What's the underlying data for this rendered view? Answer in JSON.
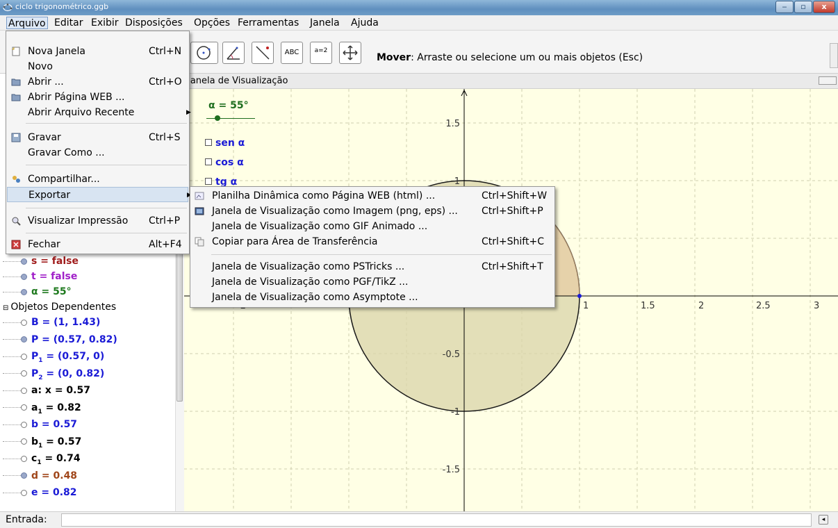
{
  "window": {
    "title": "ciclo trigonométrico.ggb",
    "min_label": "‒",
    "max_label": "▫",
    "close_label": "x"
  },
  "menubar": [
    "Arquivo",
    "Editar",
    "Exibir",
    "Disposições",
    "Opções",
    "Ferramentas",
    "Janela",
    "Ajuda"
  ],
  "toolbar": {
    "tools": [
      "circle-tool",
      "angle-tool",
      "slope-tool",
      "text-tool",
      "slider-tool",
      "move-view-tool"
    ],
    "text_tool_label": "ABC",
    "slider_tool_label": "a=2",
    "hint_bold": "Mover",
    "hint_rest": ": Arraste ou selecione um ou mais objetos (Esc)"
  },
  "file_menu": {
    "items": [
      {
        "label": "Nova Janela",
        "shortcut": "Ctrl+N"
      },
      {
        "label": "Novo",
        "shortcut": ""
      },
      {
        "label": "Abrir ...",
        "shortcut": "Ctrl+O"
      },
      {
        "label": "Abrir Página WEB ...",
        "shortcut": ""
      },
      {
        "label": "Abrir Arquivo Recente",
        "shortcut": ""
      },
      {
        "label": "Gravar",
        "shortcut": "Ctrl+S"
      },
      {
        "label": "Gravar Como ...",
        "shortcut": ""
      },
      {
        "label": "Compartilhar...",
        "shortcut": ""
      },
      {
        "label": "Exportar",
        "shortcut": ""
      },
      {
        "label": "Visualizar Impressão",
        "shortcut": "Ctrl+P"
      },
      {
        "label": "Fechar",
        "shortcut": "Alt+F4"
      }
    ]
  },
  "export_submenu": {
    "items": [
      {
        "label": "Planilha Dinâmica como Página WEB (html) ...",
        "shortcut": "Ctrl+Shift+W"
      },
      {
        "label": "Janela de Visualização como Imagem (png, eps) ...",
        "shortcut": "Ctrl+Shift+P"
      },
      {
        "label": "Janela de Visualização como GIF Animado ...",
        "shortcut": ""
      },
      {
        "label": "Copiar para Área de Transferência",
        "shortcut": "Ctrl+Shift+C"
      },
      {
        "label": "Janela de Visualização como PSTricks ...",
        "shortcut": "Ctrl+Shift+T"
      },
      {
        "label": "Janela de Visualização como PGF/TikZ ...",
        "shortcut": ""
      },
      {
        "label": "Janela de Visualização como Asymptote ...",
        "shortcut": ""
      }
    ]
  },
  "algebra": {
    "free_rows": [
      {
        "text": "s = false",
        "color": "#a01c1c",
        "dot": "filled"
      },
      {
        "text": "t = false",
        "color": "#a020c8",
        "dot": "filled"
      },
      {
        "text": "α = 55°",
        "color": "#1f7a1f",
        "dot": "filled"
      }
    ],
    "dependent_header": "Objetos Dependentes",
    "dependent_rows": [
      {
        "name": "B",
        "sub": "",
        "rest": " = (1, 1.43)",
        "color": "#1a1ad6",
        "dot": "empty"
      },
      {
        "name": "P",
        "sub": "",
        "rest": " = (0.57, 0.82)",
        "color": "#1a1ad6",
        "dot": "filled"
      },
      {
        "name": "P",
        "sub": "1",
        "rest": " = (0.57, 0)",
        "color": "#1a1ad6",
        "dot": "empty"
      },
      {
        "name": "P",
        "sub": "2",
        "rest": " = (0, 0.82)",
        "color": "#1a1ad6",
        "dot": "empty"
      },
      {
        "name": "a",
        "sub": "",
        "rest": ": x = 0.57",
        "color": "#000000",
        "dot": "empty"
      },
      {
        "name": "a",
        "sub": "1",
        "rest": " = 0.82",
        "color": "#000000",
        "dot": "empty"
      },
      {
        "name": "b",
        "sub": "",
        "rest": " = 0.57",
        "color": "#1a1ad6",
        "dot": "empty"
      },
      {
        "name": "b",
        "sub": "1",
        "rest": " = 0.57",
        "color": "#000000",
        "dot": "empty"
      },
      {
        "name": "c",
        "sub": "1",
        "rest": " = 0.74",
        "color": "#000000",
        "dot": "empty"
      },
      {
        "name": "d",
        "sub": "",
        "rest": " = 0.48",
        "color": "#a0461a",
        "dot": "filled"
      },
      {
        "name": "e",
        "sub": "",
        "rest": " = 0.82",
        "color": "#1a1ad6",
        "dot": "empty"
      }
    ]
  },
  "graphics": {
    "view_title": "Janela de Visualização",
    "slider_label": "α = 55°",
    "checkboxes": [
      "sen α",
      "cos α",
      "tg α"
    ],
    "y_ticks": [
      "1.5",
      "1",
      "-0.5",
      "-1",
      "-1.5"
    ],
    "x_ticks": [
      "1",
      "1.5",
      "2",
      "2.5",
      "3"
    ],
    "x_tick_left": "-2",
    "colors": {
      "background": "#ffffe5",
      "circle_fill": "#d9d4a8",
      "circle_stroke": "#1a1a1a",
      "sector": "#e7c9a0",
      "slider": "#1f6e1f"
    }
  },
  "input_bar": {
    "label": "Entrada:",
    "value": ""
  }
}
